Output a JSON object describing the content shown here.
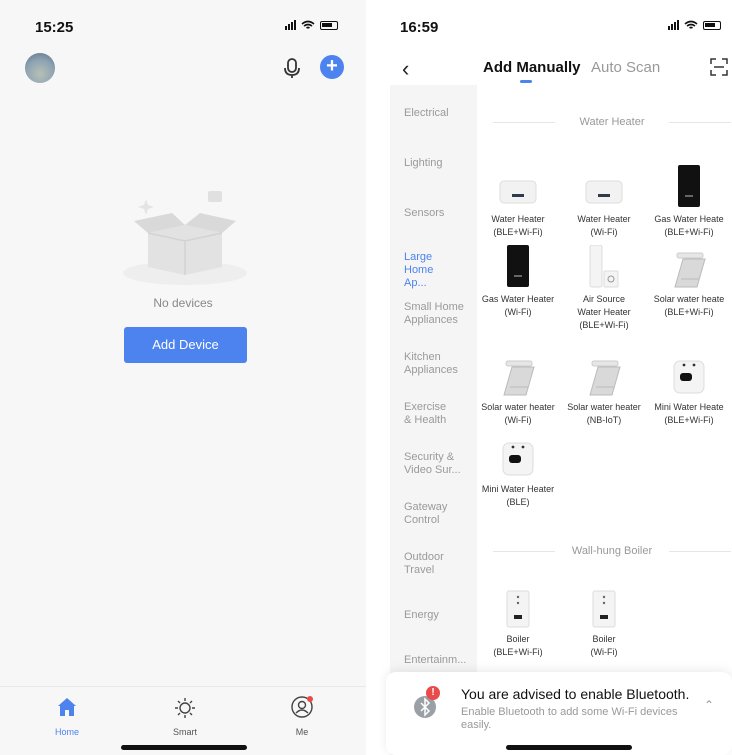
{
  "left": {
    "status_time": "15:25",
    "empty_text": "No devices",
    "add_device_label": "Add Device",
    "tabs": [
      {
        "label": "Home",
        "icon": "home-icon"
      },
      {
        "label": "Smart",
        "icon": "sun-icon"
      },
      {
        "label": "Me",
        "icon": "profile-icon"
      }
    ]
  },
  "right": {
    "status_time": "16:59",
    "tabs": {
      "manual": "Add Manually",
      "scan": "Auto Scan"
    },
    "categories": [
      "Electrical",
      "Lighting",
      "Sensors",
      "Large Home Ap...",
      "Small Home Appliances",
      "Kitchen Appliances",
      "Exercise & Health",
      "Security & Video Sur...",
      "Gateway Control",
      "Outdoor Travel",
      "Energy",
      "Entertainm..."
    ],
    "selected_category": "Large Home Ap...",
    "section1": "Water Heater",
    "devices": [
      {
        "name1": "Water Heater",
        "name2": "(BLE+Wi-Fi)"
      },
      {
        "name1": "Water Heater",
        "name2": "(Wi-Fi)"
      },
      {
        "name1": "Gas Water Heate",
        "name2": "(BLE+Wi-Fi)"
      },
      {
        "name1": "Gas Water Heater",
        "name2": "(Wi-Fi)"
      },
      {
        "name1": "Air Source",
        "name2": "Water Heater",
        "name3": "(BLE+Wi-Fi)"
      },
      {
        "name1": "Solar water heate",
        "name2": "(BLE+Wi-Fi)"
      },
      {
        "name1": "Solar water heater",
        "name2": "(Wi-Fi)"
      },
      {
        "name1": "Solar water heater",
        "name2": "(NB-IoT)"
      },
      {
        "name1": "Mini Water Heate",
        "name2": "(BLE+Wi-Fi)"
      },
      {
        "name1": "Mini Water Heater",
        "name2": "(BLE)"
      }
    ],
    "section2": "Wall-hung Boiler",
    "boilers": [
      {
        "name1": "Boiler",
        "name2": "(BLE+Wi-Fi)"
      },
      {
        "name1": "Boiler",
        "name2": "(Wi-Fi)"
      }
    ],
    "toast": {
      "badge": "!",
      "title": "You are advised to enable Bluetooth.",
      "subtitle": "Enable Bluetooth to add some Wi-Fi devices easily."
    }
  },
  "colors": {
    "accent": "#4d83ee",
    "badge": "#e94b4b"
  }
}
